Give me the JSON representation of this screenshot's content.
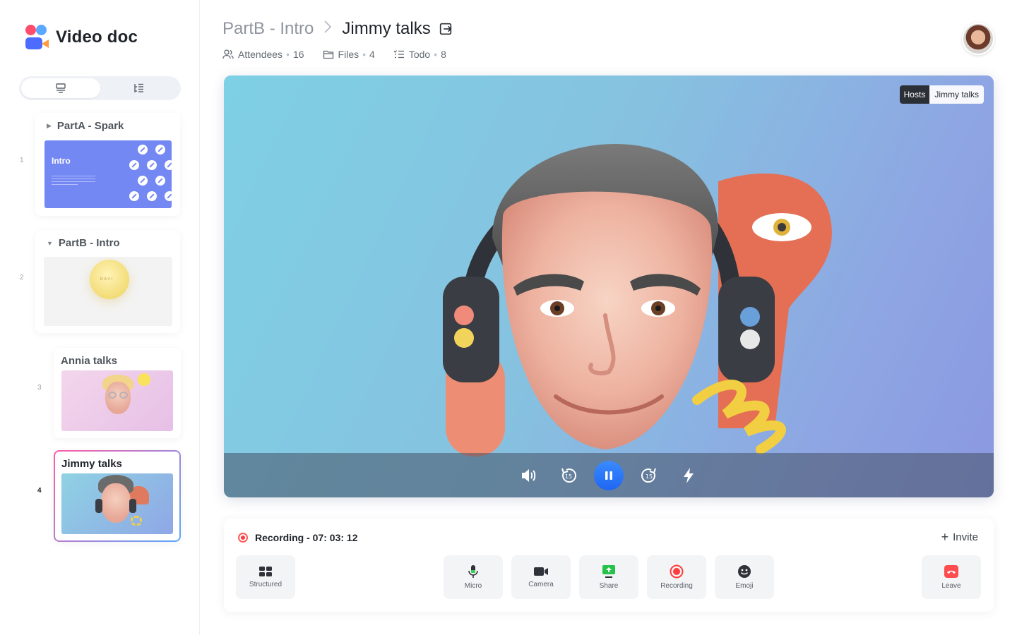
{
  "app": {
    "name": "Video doc"
  },
  "sidebar": {
    "toggle": [
      "slides-view",
      "outline-view"
    ],
    "slides": [
      {
        "num": "1",
        "section": "PartA - Spark",
        "thumb_title": "Intro"
      },
      {
        "num": "2",
        "section": "PartB - Intro",
        "thumb_title": "RAVI"
      },
      {
        "num": "3",
        "section": "Annia talks"
      },
      {
        "num": "4",
        "section": "Jimmy talks",
        "active": true
      }
    ]
  },
  "header": {
    "parent": "PartB - Intro",
    "current": "Jimmy talks",
    "attendees_label": "Attendees",
    "attendees_count": "16",
    "files_label": "Files",
    "files_count": "4",
    "todo_label": "Todo",
    "todo_count": "8",
    "dot": "•"
  },
  "stage": {
    "tag_role": "Hosts",
    "tag_name": "Jimmy talks",
    "rewind_label": "15",
    "forward_label": "15"
  },
  "panel": {
    "recording_text": "Recording - 07: 03: 12",
    "invite_label": "Invite",
    "tools": {
      "structured": "Structured",
      "micro": "Micro",
      "camera": "Camera",
      "share": "Share",
      "recording": "Recording",
      "emoji": "Emoji",
      "leave": "Leave"
    }
  },
  "colors": {
    "accent": "#1f66f2",
    "record": "#ff3b3b",
    "leave": "#ff4d4f",
    "share": "#27c24c"
  }
}
